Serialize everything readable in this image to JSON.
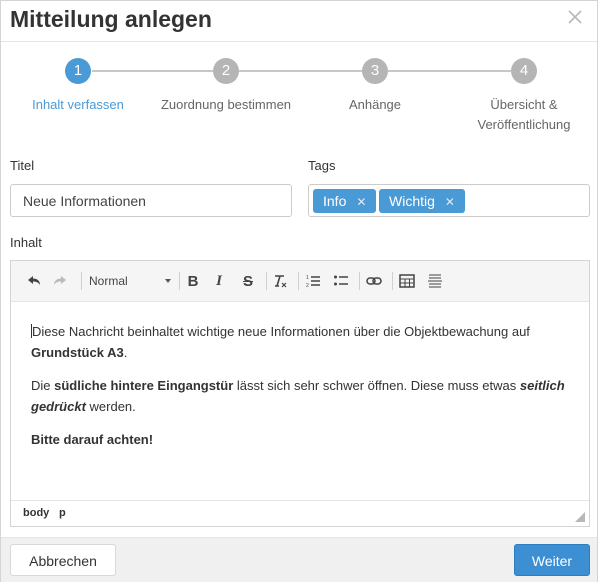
{
  "dialog": {
    "title": "Mitteilung anlegen",
    "close_icon": "close-icon"
  },
  "steps": [
    {
      "number": "1",
      "label": "Inhalt verfassen",
      "active": true
    },
    {
      "number": "2",
      "label": "Zuordnung bestimmen",
      "active": false
    },
    {
      "number": "3",
      "label": "Anhänge",
      "active": false
    },
    {
      "number": "4",
      "label": "Übersicht & Veröffentlichung",
      "active": false
    }
  ],
  "form": {
    "title_label": "Titel",
    "title_value": "Neue Informationen",
    "tags_label": "Tags",
    "tags": [
      "Info",
      "Wichtig"
    ],
    "content_label": "Inhalt"
  },
  "toolbar": {
    "format_value": "Normal",
    "icons": [
      "undo-icon",
      "redo-icon",
      "bold-icon",
      "italic-icon",
      "strikethrough-icon",
      "clear-format-icon",
      "ordered-list-icon",
      "bullet-list-icon",
      "link-icon",
      "table-icon",
      "horizontal-rule-icon"
    ],
    "bold_glyph": "B",
    "italic_glyph": "I",
    "strike_glyph": "S"
  },
  "editor": {
    "p1_text": "Diese Nachricht beinhaltet wichtige neue Informationen über die Objektbewachung auf ",
    "p1_bold": "Grundstück A3",
    "p1_end": ".",
    "p2_start": "Die ",
    "p2_bold": "südliche hintere Eingangstür",
    "p2_mid": " lässt sich sehr schwer öffnen. Diese muss etwas ",
    "p2_bolditalic": "seitlich gedrückt",
    "p2_end": " werden.",
    "p3_bold": "Bitte darauf achten!",
    "path_body": "body",
    "path_p": "p"
  },
  "footer": {
    "cancel_label": "Abbrechen",
    "next_label": "Weiter"
  },
  "colors": {
    "accent": "#4a9ad6",
    "inactive_step": "#b5b5b5",
    "primary_button": "#3c8fd2"
  }
}
